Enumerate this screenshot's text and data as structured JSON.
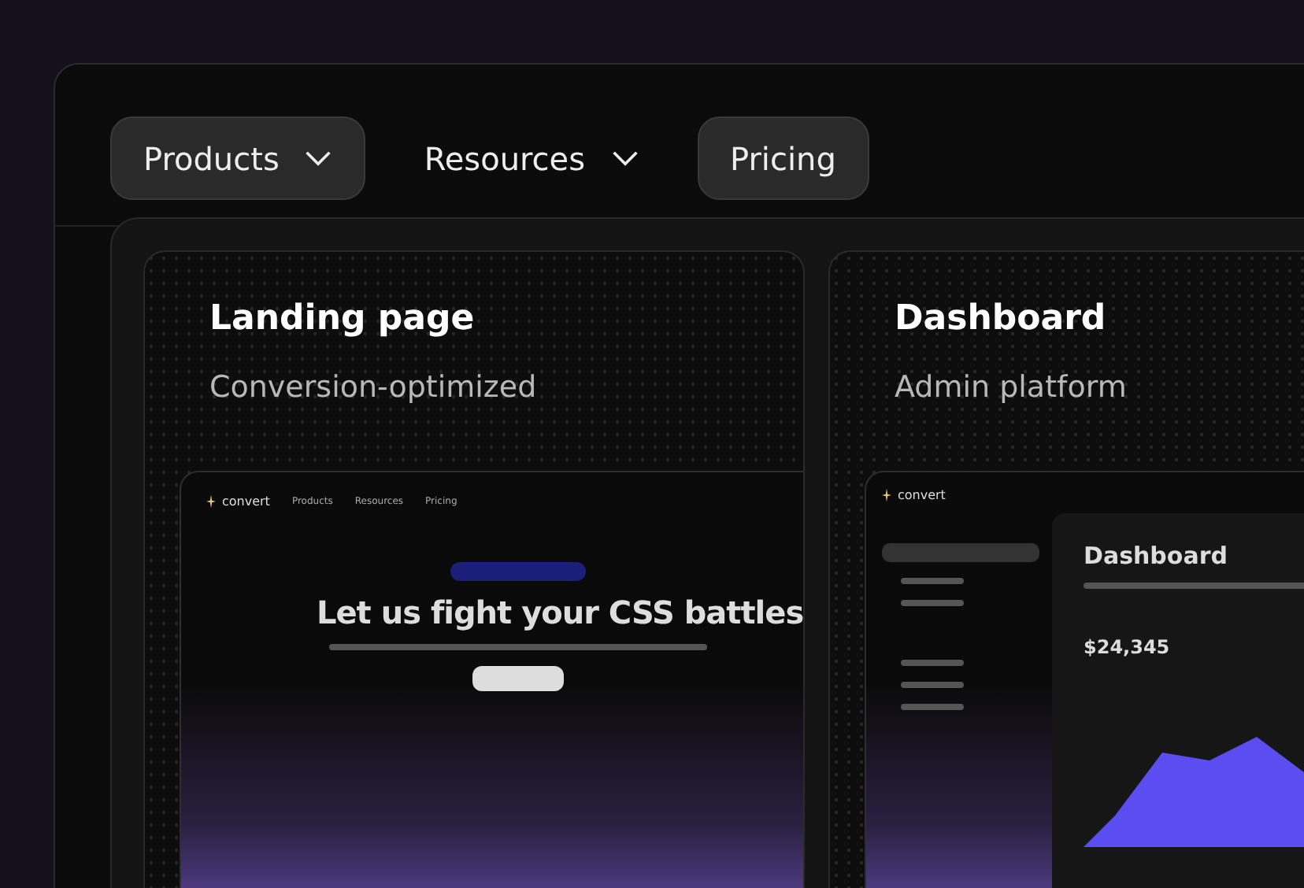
{
  "nav": [
    {
      "label": "Products",
      "dropdown": true,
      "highlighted": true
    },
    {
      "label": "Resources",
      "dropdown": true,
      "highlighted": false
    },
    {
      "label": "Pricing",
      "dropdown": false,
      "highlighted": true
    }
  ],
  "cards": [
    {
      "kind": "landing",
      "title": "Landing page",
      "subtitle": "Conversion-optimized",
      "preview": {
        "logo": "convert",
        "nav": [
          "Products",
          "Resources",
          "Pricing"
        ],
        "headline": "Let us fight your CSS battles"
      }
    },
    {
      "kind": "dashboard",
      "title": "Dashboard",
      "subtitle": "Admin platform",
      "preview": {
        "logo": "convert",
        "heading": "Dashboard",
        "stat": "$24,345"
      }
    }
  ]
}
